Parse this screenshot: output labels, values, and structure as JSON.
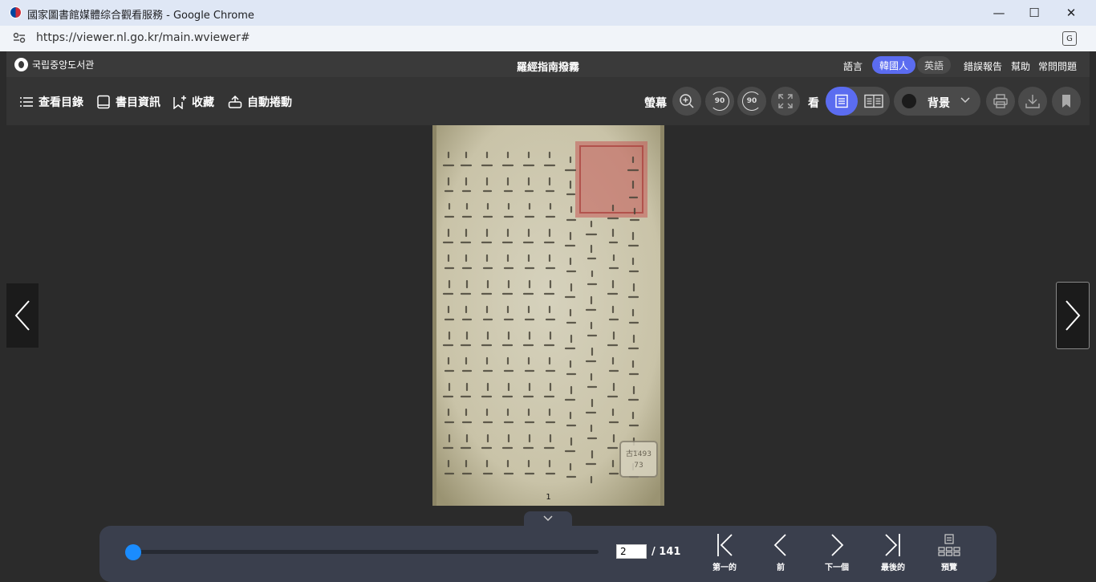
{
  "browser": {
    "tab_title": "國家圖書館媒體综合觀看服務 - Google Chrome",
    "url": "https://viewer.nl.go.kr/main.wviewer#",
    "controls": {
      "minimize": "—",
      "maximize": "☐",
      "close": "✕"
    }
  },
  "header": {
    "logo_text": "국립중앙도서관",
    "book_title": "羅經指南撥霧",
    "language_label": "語言",
    "lang_korean": "韓國人",
    "lang_english": "英語",
    "links": [
      "錯誤報告",
      "幫助",
      "常問問題"
    ]
  },
  "toolbar": {
    "toc": "查看目錄",
    "bib_info": "書目資訊",
    "bookmark": "收藏",
    "auto_scroll": "自動捲動",
    "screen_label": "螢幕",
    "rotate_left": "90",
    "rotate_right": "90",
    "view_label": "看",
    "background_label": "背景"
  },
  "viewer": {
    "page_label": "1",
    "stamp_text": "古1493\n73"
  },
  "navigation": {
    "current_page": "2",
    "total_pages": "/ 141",
    "progress_fraction": 0.007,
    "first_label": "第一的",
    "prev_label": "前",
    "next_label": "下一個",
    "last_label": "最後的",
    "preview_label": "預覽"
  },
  "colors": {
    "accent": "#5b6cf0",
    "slider": "#1a8cff",
    "bar_bg": "#3a3f4d"
  }
}
